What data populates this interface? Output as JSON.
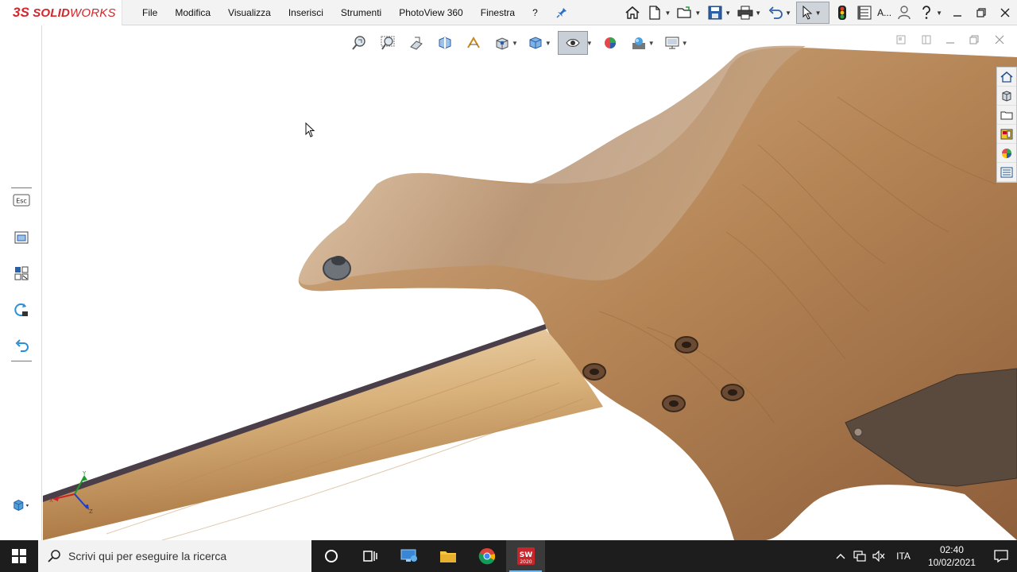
{
  "app": {
    "brand_prefix": "3S",
    "brand_solid": "SOLID",
    "brand_works": "WORKS"
  },
  "menu": {
    "items": [
      "File",
      "Modifica",
      "Visualizza",
      "Inserisci",
      "Strumenti",
      "PhotoView 360",
      "Finestra",
      "?"
    ]
  },
  "toolbar": {
    "truncated_label": "A..."
  },
  "viewport": {
    "triad_labels": {
      "x": "X",
      "y": "Y",
      "z": "Z"
    }
  },
  "taskbar": {
    "search_placeholder": "Scrivi qui per eseguire la ricerca",
    "sw_badge": "2020",
    "language": "ITA",
    "time": "02:40",
    "date": "10/02/2021"
  },
  "left_panel": {
    "esc_label": "Esc"
  },
  "colors": {
    "brand_red": "#d5262a",
    "taskbar_bg": "#1d1d1d",
    "accent_blue": "#2d6fc9"
  }
}
